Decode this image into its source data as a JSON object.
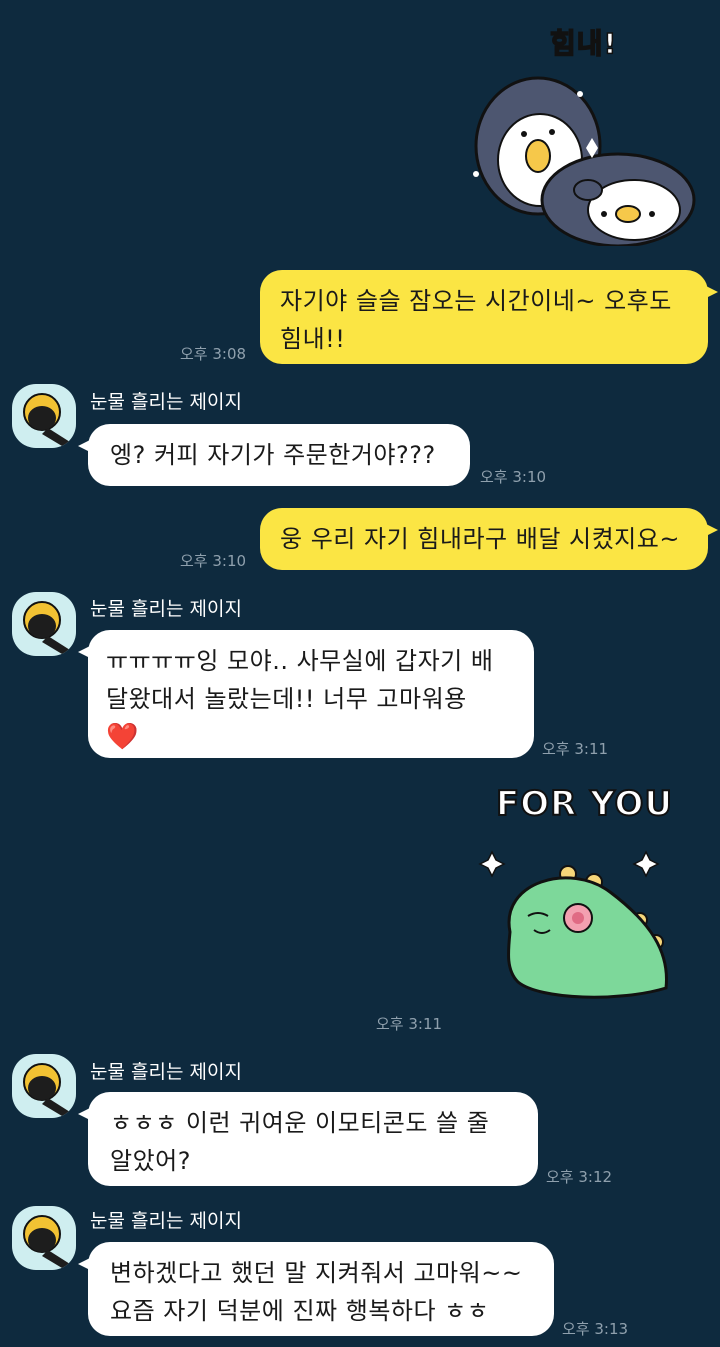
{
  "chat": {
    "contact_name": "눈물 흘리는 제이지",
    "messages": [
      {
        "id": "m1",
        "type": "sticker",
        "from": "me",
        "caption": "힘내!",
        "sticker": "penguin-hug-sticker"
      },
      {
        "id": "m2",
        "type": "text",
        "from": "me",
        "text": "자기야 슬슬 잠오는 시간이네~ 오후도 힘내!!",
        "time": "오후 3:08"
      },
      {
        "id": "m3",
        "type": "text",
        "from": "them",
        "text": "엥? 커피 자기가 주문한거야???",
        "time": "오후 3:10"
      },
      {
        "id": "m4",
        "type": "text",
        "from": "me",
        "text": "웅 우리 자기 힘내라구 배달 시켰지요~",
        "time": "오후 3:10"
      },
      {
        "id": "m5",
        "type": "text",
        "from": "them",
        "text": "ㅠㅠㅠㅠ잉 모야.. 사무실에 갑자기 배달왔대서 놀랐는데!! 너무 고마워용",
        "emoji": "❤️",
        "time": "오후 3:11"
      },
      {
        "id": "m6",
        "type": "sticker",
        "from": "me",
        "caption": "FOR YOU",
        "sticker": "dinosaur-flower-sticker",
        "time": "오후 3:11"
      },
      {
        "id": "m7",
        "type": "text",
        "from": "them",
        "text": "ㅎㅎㅎ 이런 귀여운 이모티콘도 쓸 줄 알았어?",
        "time": "오후 3:12"
      },
      {
        "id": "m8",
        "type": "text",
        "from": "them",
        "text": "변하겠다고 했던 말 지켜줘서 고마워~~ 요즘 자기 덕분에 진짜 행복하다 ㅎㅎ",
        "time": "오후 3:13"
      }
    ]
  },
  "colors": {
    "background": "#0e2a3e",
    "my_bubble": "#fbe544",
    "their_bubble": "#ffffff",
    "time_text": "#8fa0ad"
  }
}
